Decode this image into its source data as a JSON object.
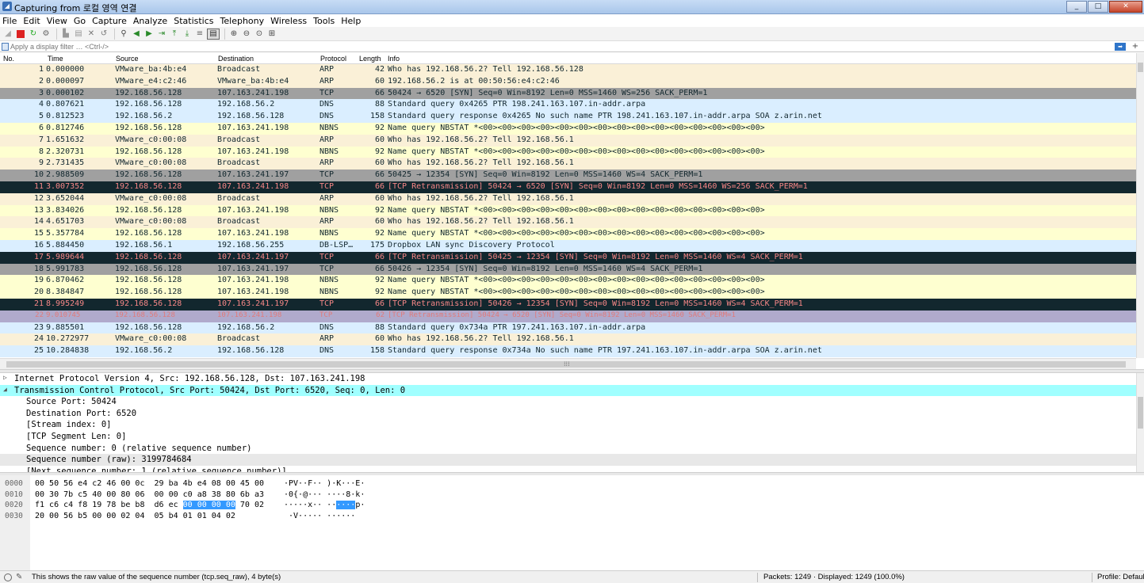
{
  "window": {
    "title": "Capturing from 로컬 영역 연결",
    "minimize": "_",
    "maximize": "□",
    "close": "✕"
  },
  "menu": [
    "File",
    "Edit",
    "View",
    "Go",
    "Capture",
    "Analyze",
    "Statistics",
    "Telephony",
    "Wireless",
    "Tools",
    "Help"
  ],
  "filter": {
    "placeholder": "Apply a display filter … <Ctrl-/>"
  },
  "columns": {
    "no": "No.",
    "time": "Time",
    "source": "Source",
    "destination": "Destination",
    "protocol": "Protocol",
    "length": "Length",
    "info": "Info"
  },
  "packets": [
    {
      "no": "1",
      "time": "0.000000",
      "src": "VMware_ba:4b:e4",
      "dst": "Broadcast",
      "proto": "ARP",
      "len": "42",
      "info": "Who has 192.168.56.2? Tell 192.168.56.128",
      "style": "arp"
    },
    {
      "no": "2",
      "time": "0.000097",
      "src": "VMware_e4:c2:46",
      "dst": "VMware_ba:4b:e4",
      "proto": "ARP",
      "len": "60",
      "info": "192.168.56.2 is at 00:50:56:e4:c2:46",
      "style": "arp"
    },
    {
      "no": "3",
      "time": "0.000102",
      "src": "192.168.56.128",
      "dst": "107.163.241.198",
      "proto": "TCP",
      "len": "66",
      "info": "50424 → 6520 [SYN] Seq=0 Win=8192 Len=0 MSS=1460 WS=256 SACK_PERM=1",
      "style": "tcpsyn"
    },
    {
      "no": "4",
      "time": "0.807621",
      "src": "192.168.56.128",
      "dst": "192.168.56.2",
      "proto": "DNS",
      "len": "88",
      "info": "Standard query 0x4265 PTR 198.241.163.107.in-addr.arpa",
      "style": "dns"
    },
    {
      "no": "5",
      "time": "0.812523",
      "src": "192.168.56.2",
      "dst": "192.168.56.128",
      "proto": "DNS",
      "len": "158",
      "info": "Standard query response 0x4265 No such name PTR 198.241.163.107.in-addr.arpa SOA z.arin.net",
      "style": "dns"
    },
    {
      "no": "6",
      "time": "0.812746",
      "src": "192.168.56.128",
      "dst": "107.163.241.198",
      "proto": "NBNS",
      "len": "92",
      "info": "Name query NBSTAT *<00><00><00><00><00><00><00><00><00><00><00><00><00><00><00>",
      "style": "nbns"
    },
    {
      "no": "7",
      "time": "1.651632",
      "src": "VMware_c0:00:08",
      "dst": "Broadcast",
      "proto": "ARP",
      "len": "60",
      "info": "Who has 192.168.56.2? Tell 192.168.56.1",
      "style": "arp"
    },
    {
      "no": "8",
      "time": "2.320731",
      "src": "192.168.56.128",
      "dst": "107.163.241.198",
      "proto": "NBNS",
      "len": "92",
      "info": "Name query NBSTAT *<00><00><00><00><00><00><00><00><00><00><00><00><00><00><00>",
      "style": "nbns"
    },
    {
      "no": "9",
      "time": "2.731435",
      "src": "VMware_c0:00:08",
      "dst": "Broadcast",
      "proto": "ARP",
      "len": "60",
      "info": "Who has 192.168.56.2? Tell 192.168.56.1",
      "style": "arp"
    },
    {
      "no": "10",
      "time": "2.988509",
      "src": "192.168.56.128",
      "dst": "107.163.241.197",
      "proto": "TCP",
      "len": "66",
      "info": "50425 → 12354 [SYN] Seq=0 Win=8192 Len=0 MSS=1460 WS=4 SACK_PERM=1",
      "style": "tcpsyn"
    },
    {
      "no": "11",
      "time": "3.007352",
      "src": "192.168.56.128",
      "dst": "107.163.241.198",
      "proto": "TCP",
      "len": "66",
      "info": "[TCP Retransmission] 50424 → 6520 [SYN] Seq=0 Win=8192 Len=0 MSS=1460 WS=256 SACK_PERM=1",
      "style": "bad"
    },
    {
      "no": "12",
      "time": "3.652044",
      "src": "VMware_c0:00:08",
      "dst": "Broadcast",
      "proto": "ARP",
      "len": "60",
      "info": "Who has 192.168.56.2? Tell 192.168.56.1",
      "style": "arp"
    },
    {
      "no": "13",
      "time": "3.834026",
      "src": "192.168.56.128",
      "dst": "107.163.241.198",
      "proto": "NBNS",
      "len": "92",
      "info": "Name query NBSTAT *<00><00><00><00><00><00><00><00><00><00><00><00><00><00><00>",
      "style": "nbns"
    },
    {
      "no": "14",
      "time": "4.651703",
      "src": "VMware_c0:00:08",
      "dst": "Broadcast",
      "proto": "ARP",
      "len": "60",
      "info": "Who has 192.168.56.2? Tell 192.168.56.1",
      "style": "arp"
    },
    {
      "no": "15",
      "time": "5.357784",
      "src": "192.168.56.128",
      "dst": "107.163.241.198",
      "proto": "NBNS",
      "len": "92",
      "info": "Name query NBSTAT *<00><00><00><00><00><00><00><00><00><00><00><00><00><00><00>",
      "style": "nbns"
    },
    {
      "no": "16",
      "time": "5.884450",
      "src": "192.168.56.1",
      "dst": "192.168.56.255",
      "proto": "DB-LSP…",
      "len": "175",
      "info": "Dropbox LAN sync Discovery Protocol",
      "style": "udp"
    },
    {
      "no": "17",
      "time": "5.989644",
      "src": "192.168.56.128",
      "dst": "107.163.241.197",
      "proto": "TCP",
      "len": "66",
      "info": "[TCP Retransmission] 50425 → 12354 [SYN] Seq=0 Win=8192 Len=0 MSS=1460 WS=4 SACK_PERM=1",
      "style": "bad"
    },
    {
      "no": "18",
      "time": "5.991783",
      "src": "192.168.56.128",
      "dst": "107.163.241.197",
      "proto": "TCP",
      "len": "66",
      "info": "50426 → 12354 [SYN] Seq=0 Win=8192 Len=0 MSS=1460 WS=4 SACK_PERM=1",
      "style": "tcpsyn"
    },
    {
      "no": "19",
      "time": "6.870462",
      "src": "192.168.56.128",
      "dst": "107.163.241.198",
      "proto": "NBNS",
      "len": "92",
      "info": "Name query NBSTAT *<00><00><00><00><00><00><00><00><00><00><00><00><00><00><00>",
      "style": "nbns"
    },
    {
      "no": "20",
      "time": "8.384847",
      "src": "192.168.56.128",
      "dst": "107.163.241.198",
      "proto": "NBNS",
      "len": "92",
      "info": "Name query NBSTAT *<00><00><00><00><00><00><00><00><00><00><00><00><00><00><00>",
      "style": "nbns"
    },
    {
      "no": "21",
      "time": "8.995249",
      "src": "192.168.56.128",
      "dst": "107.163.241.197",
      "proto": "TCP",
      "len": "66",
      "info": "[TCP Retransmission] 50426 → 12354 [SYN] Seq=0 Win=8192 Len=0 MSS=1460 WS=4 SACK_PERM=1",
      "style": "bad"
    },
    {
      "no": "22",
      "time": "9.010745",
      "src": "192.168.56.128",
      "dst": "107.163.241.198",
      "proto": "TCP",
      "len": "62",
      "info": "[TCP Retransmission] 50424 → 6520 [SYN] Seq=0 Win=8192 Len=0 MSS=1460 SACK_PERM=1",
      "style": "sel"
    },
    {
      "no": "23",
      "time": "9.885501",
      "src": "192.168.56.128",
      "dst": "192.168.56.2",
      "proto": "DNS",
      "len": "88",
      "info": "Standard query 0x734a PTR 197.241.163.107.in-addr.arpa",
      "style": "dns"
    },
    {
      "no": "24",
      "time": "10.272977",
      "src": "VMware_c0:00:08",
      "dst": "Broadcast",
      "proto": "ARP",
      "len": "60",
      "info": "Who has 192.168.56.2? Tell 192.168.56.1",
      "style": "arp"
    },
    {
      "no": "25",
      "time": "10.284838",
      "src": "192.168.56.2",
      "dst": "192.168.56.128",
      "proto": "DNS",
      "len": "158",
      "info": "Standard query response 0x734a No such name PTR 197.241.163.107.in-addr.arpa SOA z.arin.net",
      "style": "dns"
    }
  ],
  "details": [
    {
      "text": "Internet Protocol Version 4, Src: 192.168.56.128, Dst: 107.163.241.198",
      "level": 0,
      "toggle": "▷",
      "style": ""
    },
    {
      "text": "Transmission Control Protocol, Src Port: 50424, Dst Port: 6520, Seq: 0, Len: 0",
      "level": 0,
      "toggle": "◢",
      "style": "hl"
    },
    {
      "text": "Source Port: 50424",
      "level": 1,
      "toggle": "",
      "style": ""
    },
    {
      "text": "Destination Port: 6520",
      "level": 1,
      "toggle": "",
      "style": ""
    },
    {
      "text": "[Stream index: 0]",
      "level": 1,
      "toggle": "",
      "style": ""
    },
    {
      "text": "[TCP Segment Len: 0]",
      "level": 1,
      "toggle": "",
      "style": ""
    },
    {
      "text": "Sequence number: 0    (relative sequence number)",
      "level": 1,
      "toggle": "",
      "style": ""
    },
    {
      "text": "Sequence number (raw): 3199784684",
      "level": 1,
      "toggle": "",
      "style": "sel"
    },
    {
      "text": "[Next sequence number: 1    (relative sequence number)]",
      "level": 1,
      "toggle": "",
      "style": ""
    }
  ],
  "bytes": [
    {
      "offset": "0000",
      "hex_pre": "00 50 56 e4 c2 46 00 0c  29 ba 4b e4 08 00 45 00",
      "hex_sel": "",
      "hex_post": "",
      "asc_pre": "·PV··F·· )·K···E·",
      "asc_sel": "",
      "asc_post": ""
    },
    {
      "offset": "0010",
      "hex_pre": "00 30 7b c5 40 00 80 06  00 00 c0 a8 38 80 6b a3",
      "hex_sel": "",
      "hex_post": "",
      "asc_pre": "·0{·@··· ····8·k·",
      "asc_sel": "",
      "asc_post": ""
    },
    {
      "offset": "0020",
      "hex_pre": "f1 c6 c4 f8 19 78 be b8  d6 ec ",
      "hex_sel": "00 00 00 00",
      "hex_post": " 70 02",
      "asc_pre": "·····x·· ··",
      "asc_sel": "····",
      "asc_post": "p·"
    },
    {
      "offset": "0030",
      "hex_pre": "20 00 56 b5 00 00 02 04  05 b4 01 01 04 02",
      "hex_sel": "",
      "hex_post": "",
      "asc_pre": " ·V····· ······",
      "asc_sel": "",
      "asc_post": ""
    }
  ],
  "status": {
    "message": "This shows the raw value of the sequence number (tcp.seq_raw), 4 byte(s)",
    "packets": "Packets: 1249 · Displayed: 1249 (100.0%)",
    "profile": "Profile: Default"
  }
}
